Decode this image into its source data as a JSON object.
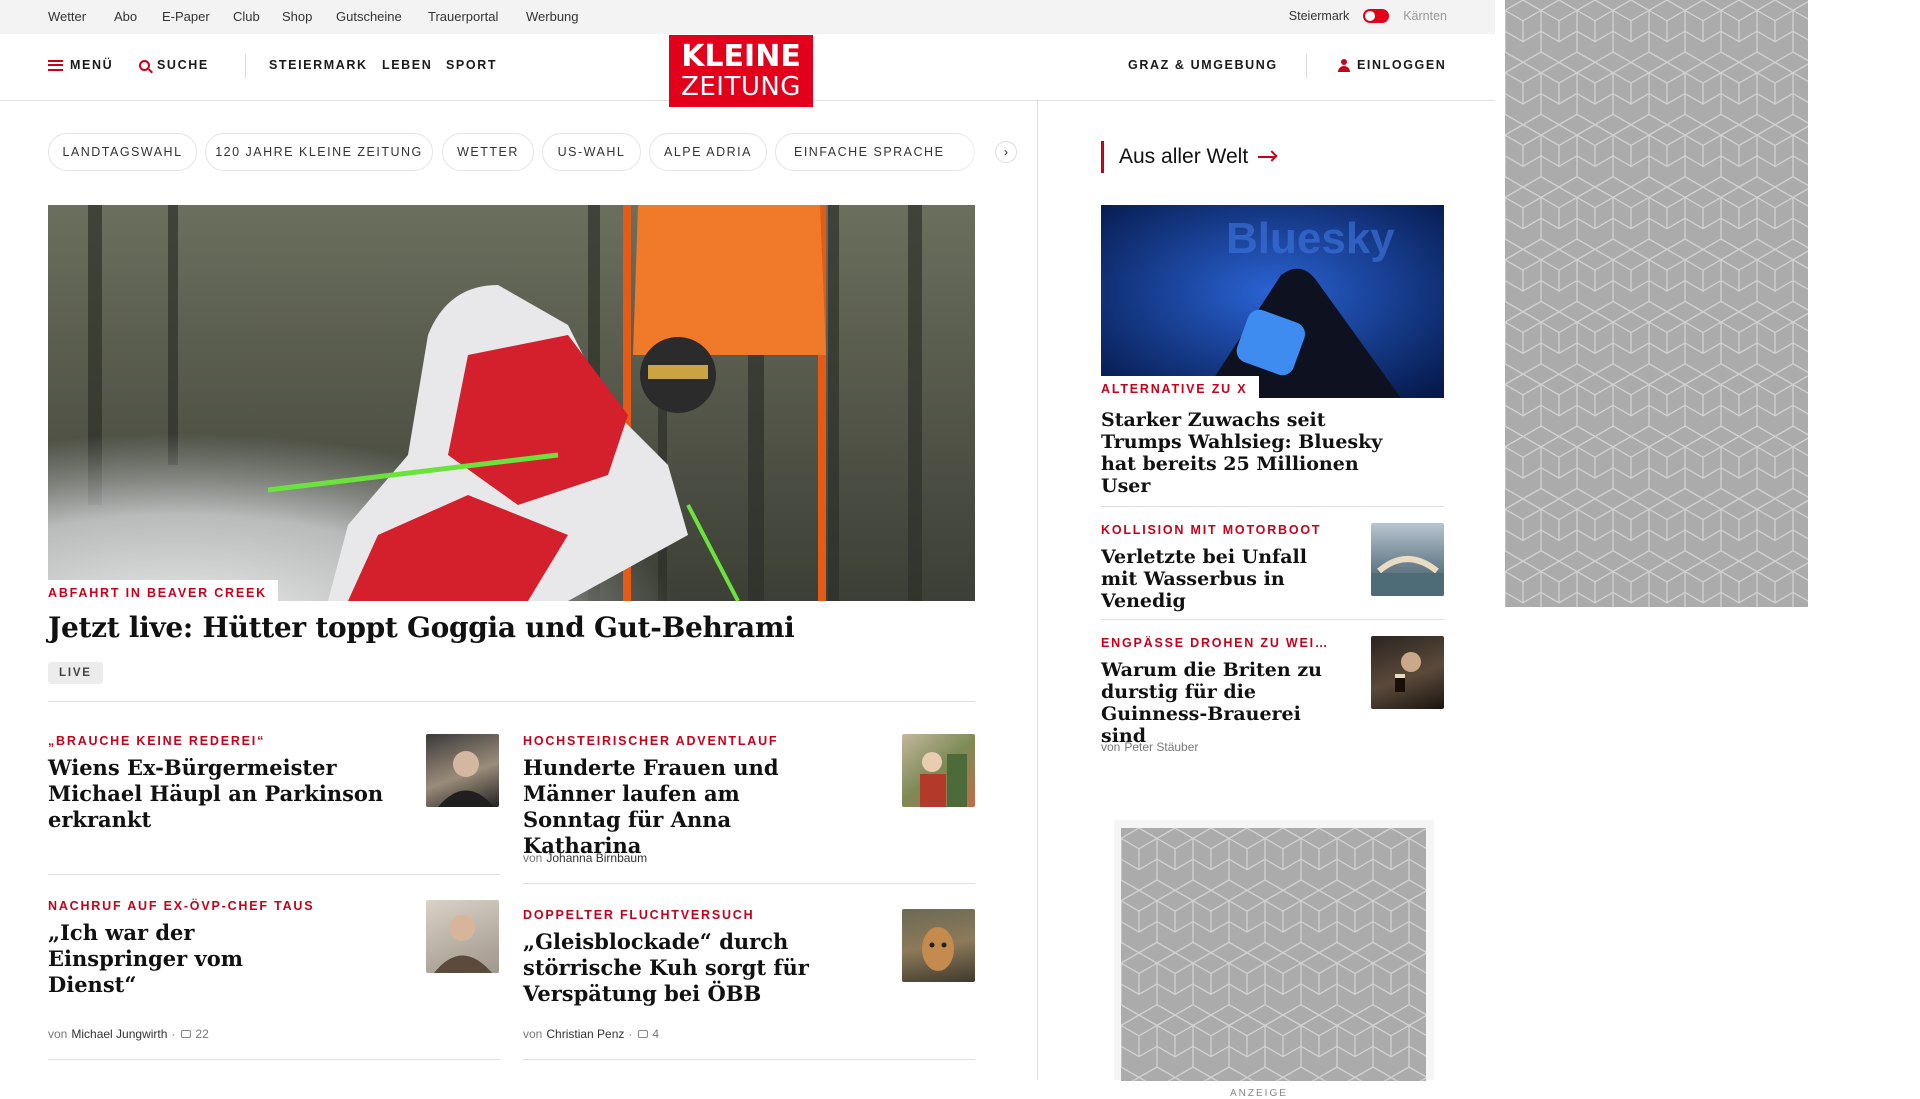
{
  "utilbar": {
    "links": [
      "Wetter",
      "Abo",
      "E-Paper",
      "Club",
      "Shop",
      "Gutscheine",
      "Trauerportal",
      "Werbung"
    ],
    "region_left": "Steiermark",
    "region_right": "Kärnten"
  },
  "header": {
    "menu": "MENÜ",
    "search": "SUCHE",
    "nav": [
      "STEIERMARK",
      "LEBEN",
      "SPORT"
    ],
    "logo_line1": "KLEINE",
    "logo_line2": "ZEITUNG",
    "region": "GRAZ & UMGEBUNG",
    "login": "EINLOGGEN"
  },
  "chips": [
    "LANDTAGSWAHL",
    "120 JAHRE KLEINE ZEITUNG",
    "WETTER",
    "US-WAHL",
    "ALPE ADRIA",
    "EINFACHE SPRACHE"
  ],
  "hero": {
    "kicker": "ABFAHRT IN BEAVER CREEK",
    "title": "Jetzt live: Hütter toppt Goggia und Gut-Behrami",
    "badge": "LIVE"
  },
  "articles": [
    {
      "kicker": "„BRAUCHE KEINE REDEREI“",
      "title": "Wiens Ex-Bürgermeister Michael Häupl an Parkinson erkrankt"
    },
    {
      "kicker": "HOCHSTEIRISCHER ADVENTLAUF",
      "title": "Hunderte Frauen und Männer laufen am Sonntag für Anna Katharina",
      "by": "von",
      "author": "Johanna Birnbaum"
    },
    {
      "kicker": "NACHRUF AUF EX-ÖVP-CHEF TAUS",
      "title": "„Ich war der Einspringer vom Dienst“",
      "by": "von",
      "author": "Michael Jungwirth",
      "comments": "22"
    },
    {
      "kicker": "DOPPELTER FLUCHTVERSUCH",
      "title": "„Gleisblockade“ durch störrische Kuh sorgt für Verspätung bei ÖBB",
      "by": "von",
      "author": "Christian Penz",
      "comments": "4"
    }
  ],
  "sidebar": {
    "section": "Aus aller Welt",
    "top": {
      "img_text": "Bluesky",
      "kicker": "ALTERNATIVE ZU X",
      "title": "Starker Zuwachs seit Trumps Wahlsieg: Bluesky hat bereits 25 Millionen User"
    },
    "items": [
      {
        "kicker": "KOLLISION MIT MOTORBOOT",
        "title": "Verletzte bei Unfall mit Wasserbus in Venedig"
      },
      {
        "kicker": "ENGPÄSSE DROHEN ZU WEI…",
        "title": "Warum die Briten zu durstig für die Guinness-Brauerei sind",
        "by": "von",
        "author": "Peter Stäuber"
      }
    ]
  },
  "ad": {
    "label": "ANZEIGE"
  },
  "colors": {
    "brand_red": "#e3001b",
    "kicker_red": "#c8001a",
    "ad_gray": "#ababab"
  }
}
